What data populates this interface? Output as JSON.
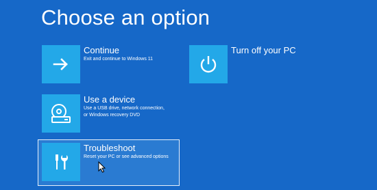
{
  "screen": {
    "title": "Choose an option"
  },
  "options": [
    {
      "title": "Continue",
      "description": [
        "Exit and continue to Windows 11"
      ],
      "icon": "arrow-right-icon"
    },
    {
      "title": "Use a device",
      "description": [
        "Use a USB drive, network connection,",
        "or Windows recovery DVD"
      ],
      "icon": "disc-drive-icon"
    },
    {
      "title": "Troubleshoot",
      "description": [
        "Reset your PC or see advanced options"
      ],
      "icon": "tools-icon",
      "selected": true
    },
    {
      "title": "Turn off your PC",
      "description": [],
      "icon": "power-icon"
    }
  ],
  "colors": {
    "background": "#1668c8",
    "tile": "#23a8e8",
    "selected_fill": "#2a7bd2",
    "selected_border": "#e8f1fb",
    "text": "#ffffff"
  }
}
